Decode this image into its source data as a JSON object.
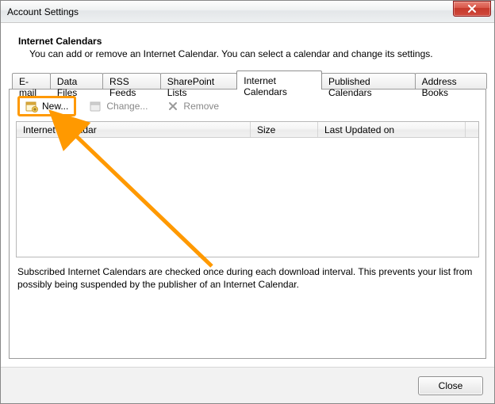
{
  "window": {
    "title": "Account Settings"
  },
  "header": {
    "heading": "Internet Calendars",
    "description": "You can add or remove an Internet Calendar. You can select a calendar and change its settings."
  },
  "tabs": [
    {
      "label": "E-mail"
    },
    {
      "label": "Data Files"
    },
    {
      "label": "RSS Feeds"
    },
    {
      "label": "SharePoint Lists"
    },
    {
      "label": "Internet Calendars"
    },
    {
      "label": "Published Calendars"
    },
    {
      "label": "Address Books"
    }
  ],
  "toolbar": {
    "new_label": "New...",
    "change_label": "Change...",
    "remove_label": "Remove"
  },
  "columns": {
    "name": "Internet Calendar",
    "size": "Size",
    "updated": "Last Updated on"
  },
  "note": "Subscribed Internet Calendars are checked once during each download interval. This prevents your list from possibly being suspended by the publisher of an Internet Calendar.",
  "footer": {
    "close_label": "Close"
  }
}
